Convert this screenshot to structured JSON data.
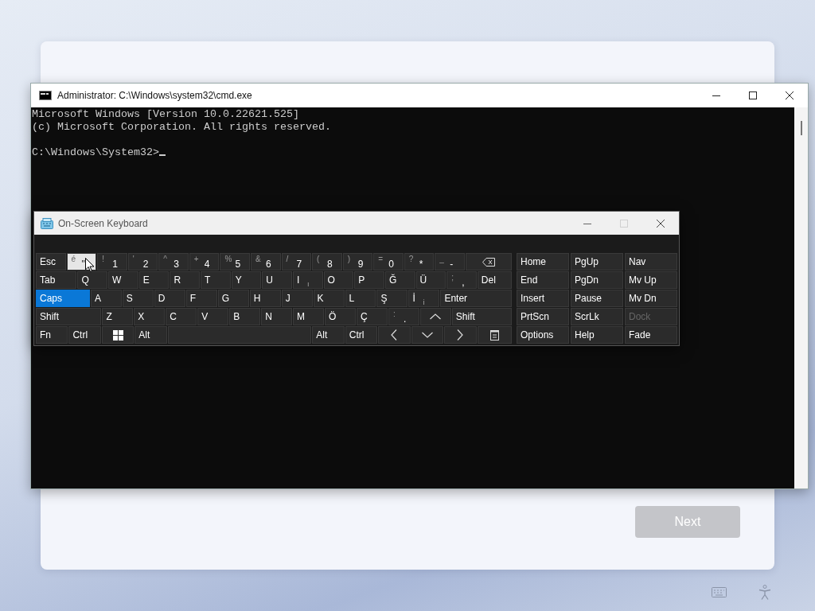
{
  "setup_card": {
    "next_button": {
      "label": "Next",
      "disabled": true
    }
  },
  "cmd_window": {
    "title": "Administrator: C:\\Windows\\system32\\cmd.exe",
    "output": [
      "Microsoft Windows [Version 10.0.22621.525]",
      "(c) Microsoft Corporation. All rights reserved."
    ],
    "prompt": "C:\\Windows\\System32>"
  },
  "keyboard_window": {
    "title": "On-Screen Keyboard",
    "main_rows": [
      [
        {
          "kind": "text",
          "label": "Esc",
          "on": false,
          "hovered": false
        },
        {
          "kind": "dual",
          "shift": "é",
          "label": "\"",
          "on": false,
          "hovered": true
        },
        {
          "kind": "dual",
          "shift": "!",
          "label": "1",
          "on": false,
          "hovered": false
        },
        {
          "kind": "dual",
          "shift": "'",
          "label": "2",
          "on": false,
          "hovered": false
        },
        {
          "kind": "dual",
          "shift": "^",
          "label": "3",
          "on": false,
          "hovered": false
        },
        {
          "kind": "dual",
          "shift": "+",
          "label": "4",
          "on": false,
          "hovered": false
        },
        {
          "kind": "dual",
          "shift": "%",
          "label": "5",
          "on": false,
          "hovered": false
        },
        {
          "kind": "dual",
          "shift": "&",
          "label": "6",
          "on": false,
          "hovered": false
        },
        {
          "kind": "dual",
          "shift": "/",
          "label": "7",
          "on": false,
          "hovered": false
        },
        {
          "kind": "dual",
          "shift": "(",
          "label": "8",
          "on": false,
          "hovered": false
        },
        {
          "kind": "dual",
          "shift": ")",
          "label": "9",
          "on": false,
          "hovered": false
        },
        {
          "kind": "dual",
          "shift": "=",
          "label": "0",
          "on": false,
          "hovered": false
        },
        {
          "kind": "dual",
          "shift": "?",
          "label": "*",
          "on": false,
          "hovered": false
        },
        {
          "kind": "dual",
          "shift": "_",
          "label": "-",
          "on": false,
          "hovered": false
        },
        {
          "kind": "backspace",
          "on": false,
          "hovered": false
        }
      ],
      [
        {
          "kind": "text",
          "label": "Tab",
          "on": false,
          "hovered": false
        },
        {
          "kind": "text",
          "label": "Q",
          "on": false,
          "hovered": false
        },
        {
          "kind": "text",
          "label": "W",
          "on": false,
          "hovered": false
        },
        {
          "kind": "text",
          "label": "E",
          "on": false,
          "hovered": false
        },
        {
          "kind": "text",
          "label": "R",
          "on": false,
          "hovered": false
        },
        {
          "kind": "text",
          "label": "T",
          "on": false,
          "hovered": false
        },
        {
          "kind": "text",
          "label": "Y",
          "on": false,
          "hovered": false
        },
        {
          "kind": "text",
          "label": "U",
          "on": false,
          "hovered": false
        },
        {
          "kind": "alt",
          "label": "I",
          "alt": "ı",
          "on": false,
          "hovered": false
        },
        {
          "kind": "text",
          "label": "O",
          "on": false,
          "hovered": false
        },
        {
          "kind": "text",
          "label": "P",
          "on": false,
          "hovered": false
        },
        {
          "kind": "text",
          "label": "Ğ",
          "on": false,
          "hovered": false
        },
        {
          "kind": "text",
          "label": "Ü",
          "on": false,
          "hovered": false
        },
        {
          "kind": "dual",
          "shift": ";",
          "label": ",",
          "on": false,
          "hovered": false
        },
        {
          "kind": "text",
          "label": "Del",
          "on": false,
          "hovered": false
        }
      ],
      [
        {
          "kind": "text",
          "label": "Caps",
          "on": true,
          "hovered": false
        },
        {
          "kind": "text",
          "label": "A",
          "on": false,
          "hovered": false
        },
        {
          "kind": "text",
          "label": "S",
          "on": false,
          "hovered": false
        },
        {
          "kind": "text",
          "label": "D",
          "on": false,
          "hovered": false
        },
        {
          "kind": "text",
          "label": "F",
          "on": false,
          "hovered": false
        },
        {
          "kind": "text",
          "label": "G",
          "on": false,
          "hovered": false
        },
        {
          "kind": "text",
          "label": "H",
          "on": false,
          "hovered": false
        },
        {
          "kind": "text",
          "label": "J",
          "on": false,
          "hovered": false
        },
        {
          "kind": "text",
          "label": "K",
          "on": false,
          "hovered": false
        },
        {
          "kind": "text",
          "label": "L",
          "on": false,
          "hovered": false
        },
        {
          "kind": "text",
          "label": "Ş",
          "on": false,
          "hovered": false
        },
        {
          "kind": "alt",
          "label": "İ",
          "alt": "i",
          "on": false,
          "hovered": false
        },
        {
          "kind": "text",
          "label": "Enter",
          "on": false,
          "hovered": false
        }
      ],
      [
        {
          "kind": "text",
          "label": "Shift",
          "on": false,
          "hovered": false
        },
        {
          "kind": "text",
          "label": "Z",
          "on": false,
          "hovered": false
        },
        {
          "kind": "text",
          "label": "X",
          "on": false,
          "hovered": false
        },
        {
          "kind": "text",
          "label": "C",
          "on": false,
          "hovered": false
        },
        {
          "kind": "text",
          "label": "V",
          "on": false,
          "hovered": false
        },
        {
          "kind": "text",
          "label": "B",
          "on": false,
          "hovered": false
        },
        {
          "kind": "text",
          "label": "N",
          "on": false,
          "hovered": false
        },
        {
          "kind": "text",
          "label": "M",
          "on": false,
          "hovered": false
        },
        {
          "kind": "text",
          "label": "Ö",
          "on": false,
          "hovered": false
        },
        {
          "kind": "text",
          "label": "Ç",
          "on": false,
          "hovered": false
        },
        {
          "kind": "dual",
          "shift": ":",
          "label": ".",
          "on": false,
          "hovered": false
        },
        {
          "kind": "up",
          "on": false,
          "hovered": false
        },
        {
          "kind": "text",
          "label": "Shift",
          "on": false,
          "hovered": false
        }
      ],
      [
        {
          "kind": "text",
          "label": "Fn",
          "on": false,
          "hovered": false
        },
        {
          "kind": "text",
          "label": "Ctrl",
          "on": false,
          "hovered": false
        },
        {
          "kind": "windows",
          "on": false,
          "hovered": false
        },
        {
          "kind": "text",
          "label": "Alt",
          "on": false,
          "hovered": false
        },
        {
          "kind": "space",
          "on": false,
          "hovered": false
        },
        {
          "kind": "text",
          "label": "Alt",
          "on": false,
          "hovered": false
        },
        {
          "kind": "text",
          "label": "Ctrl",
          "on": false,
          "hovered": false
        },
        {
          "kind": "left",
          "on": false,
          "hovered": false
        },
        {
          "kind": "down",
          "on": false,
          "hovered": false
        },
        {
          "kind": "right",
          "on": false,
          "hovered": false
        },
        {
          "kind": "menu",
          "on": false,
          "hovered": false
        }
      ]
    ],
    "nav_rows": [
      [
        {
          "label": "Home",
          "disabled": false
        },
        {
          "label": "PgUp",
          "disabled": false
        },
        {
          "label": "Nav",
          "disabled": false
        }
      ],
      [
        {
          "label": "End",
          "disabled": false
        },
        {
          "label": "PgDn",
          "disabled": false
        },
        {
          "label": "Mv Up",
          "disabled": false
        }
      ],
      [
        {
          "label": "Insert",
          "disabled": false
        },
        {
          "label": "Pause",
          "disabled": false
        },
        {
          "label": "Mv Dn",
          "disabled": false
        }
      ],
      [
        {
          "label": "PrtScn",
          "disabled": false
        },
        {
          "label": "ScrLk",
          "disabled": false
        },
        {
          "label": "Dock",
          "disabled": true
        }
      ],
      [
        {
          "label": "Options",
          "disabled": false
        },
        {
          "label": "Help",
          "disabled": false
        },
        {
          "label": "Fade",
          "disabled": false
        }
      ]
    ]
  }
}
